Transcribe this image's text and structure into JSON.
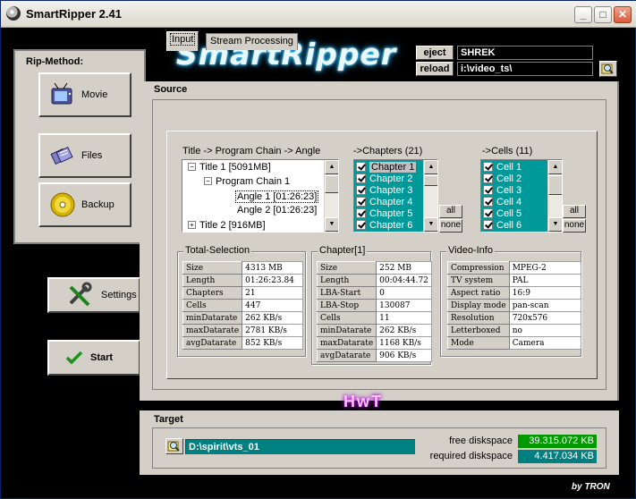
{
  "window": {
    "title": "SmartRipper 2.41"
  },
  "logo": {
    "text": "SmartRipper"
  },
  "disc": {
    "eject_label": "eject",
    "reload_label": "reload",
    "disc_name": "SHREK",
    "path": "i:\\video_ts\\"
  },
  "rip_method": {
    "title": "Rip-Method:",
    "buttons": [
      {
        "label": "Movie"
      },
      {
        "label": "Files"
      },
      {
        "label": "Backup"
      }
    ]
  },
  "side_buttons": {
    "settings_label": "Settings",
    "start_label": "Start"
  },
  "source": {
    "label": "Source",
    "tabs": [
      {
        "label": "Input"
      },
      {
        "label": "Stream Processing"
      }
    ],
    "tree_header": "Title -> Program Chain -> Angle",
    "tree": [
      {
        "text": "Title 1 [5091MB]",
        "toggle": "−"
      },
      {
        "text": "Program Chain 1",
        "toggle": "−"
      },
      {
        "text": "Angle 1 [01:26:23]",
        "toggle": ""
      },
      {
        "text": "Angle 2 [01:26:23]",
        "toggle": ""
      },
      {
        "text": "Title 2 [916MB]",
        "toggle": "+"
      }
    ],
    "chapters_header": "->Chapters (21)",
    "chapters": [
      "Chapter 1",
      "Chapter 2",
      "Chapter 3",
      "Chapter 4",
      "Chapter 5",
      "Chapter 6"
    ],
    "cells_header": "->Cells (11)",
    "cells": [
      "Cell 1",
      "Cell 2",
      "Cell 3",
      "Cell 4",
      "Cell 5",
      "Cell 6"
    ],
    "all_label": "all",
    "none_label": "none",
    "total_selection": {
      "title": "Total-Selection",
      "rows": [
        [
          "Size",
          "4313 MB"
        ],
        [
          "Length",
          "01:26:23.84"
        ],
        [
          "Chapters",
          "21"
        ],
        [
          "Cells",
          "447"
        ],
        [
          "minDatarate",
          "262 KB/s"
        ],
        [
          "maxDatarate",
          "2781 KB/s"
        ],
        [
          "avgDatarate",
          "852 KB/s"
        ]
      ]
    },
    "chapter_info": {
      "title": "Chapter[1]",
      "rows": [
        [
          "Size",
          "252 MB"
        ],
        [
          "Length",
          "00:04:44.72"
        ],
        [
          "LBA-Start",
          "0"
        ],
        [
          "LBA-Stop",
          "130087"
        ],
        [
          "Cells",
          "11"
        ],
        [
          "minDatarate",
          "262 KB/s"
        ],
        [
          "maxDatarate",
          "1168 KB/s"
        ],
        [
          "avgDatarate",
          "906 KB/s"
        ]
      ]
    },
    "video_info": {
      "title": "Video-Info",
      "rows": [
        [
          "Compression",
          "MPEG-2"
        ],
        [
          "TV system",
          "PAL"
        ],
        [
          "Aspect ratio",
          "16:9"
        ],
        [
          "Display mode",
          "pan-scan"
        ],
        [
          "Resolution",
          "720x576"
        ],
        [
          "Letterboxed",
          "no"
        ],
        [
          "Mode",
          "Camera"
        ]
      ]
    }
  },
  "watermark": "HwT",
  "target": {
    "label": "Target",
    "path": "D:\\spirit\\vts_01",
    "free_label": "free diskspace",
    "free_value": "39.315.072 KB",
    "required_label": "required diskspace",
    "required_value": "4.417.034 KB"
  },
  "credit": "by TRON",
  "colors": {
    "accent_teal": "#008080",
    "list_teal": "#009999",
    "free_green": "#009900"
  }
}
